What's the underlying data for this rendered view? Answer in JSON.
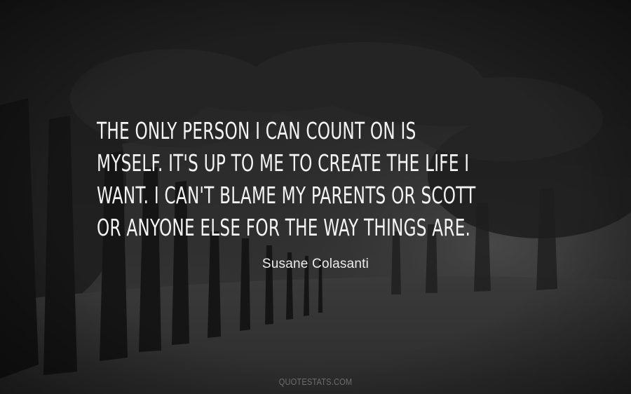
{
  "quote": {
    "lines": [
      "THE ONLY PERSON I CAN COUNT ON IS",
      "MYSELF. IT'S UP TO ME TO CREATE THE LIFE I",
      "WANT. I CAN'T BLAME MY PARENTS OR SCOTT",
      "OR ANYONE ELSE FOR THE WAY THINGS ARE."
    ]
  },
  "author": "Susane Colasanti",
  "watermark": "QUOTESTATS.COM"
}
